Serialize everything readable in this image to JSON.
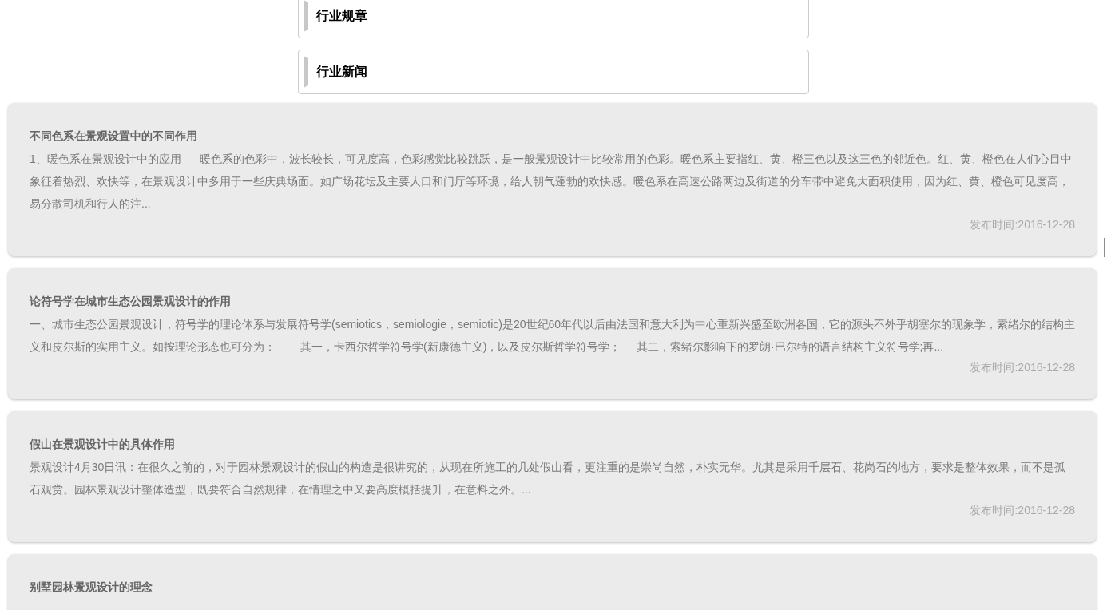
{
  "categories": [
    {
      "label": "行业规章"
    },
    {
      "label": "行业新闻"
    }
  ],
  "articles": [
    {
      "title": "不同色系在景观设置中的不同作用",
      "summary": "1、暖色系在景观设计中的应用      暖色系的色彩中，波长较长，可见度高，色彩感觉比较跳跃，是一般景观设计中比较常用的色彩。暖色系主要指红、黄、橙三色以及这三色的邻近色。红、黄、橙色在人们心目中象征着热烈、欢快等，在景观设计中多用于一些庆典场面。如广场花坛及主要人口和门厅等环境，给人朝气蓬勃的欢快感。暖色系在高速公路两边及街道的分车带中避免大面积使用，因为红、黄、橙色可见度高，易分散司机和行人的注...",
      "date": "发布时间:2016-12-28"
    },
    {
      "title": "论符号学在城市生态公园景观设计的作用",
      "summary": "一、城市生态公园景观设计，符号学的理论体系与发展符号学(semiotics，semiologie，semiotic)是20世纪60年代以后由法国和意大利为中心重新兴盛至欧洲各国，它的源头不外乎胡塞尔的现象学，索绪尔的结构主义和皮尔斯的实用主义。如按理论形态也可分为：        其一，卡西尔哲学符号学(新康德主义)，以及皮尔斯哲学符号学；     其二，索绪尔影响下的罗朗·巴尔特的语言结构主义符号学;再...",
      "date": "发布时间:2016-12-28"
    },
    {
      "title": "假山在景观设计中的具体作用",
      "summary": "景观设计4月30日讯：在很久之前的，对于园林景观设计的假山的构造是很讲究的，从现在所施工的几处假山看，更注重的是崇尚自然，朴实无华。尤其是采用千层石、花岗石的地方，要求是整体效果，而不是孤石观赏。园林景观设计整体造型，既要符合自然规律，在情理之中又要高度概括提升，在意料之外。...",
      "date": "发布时间:2016-12-28"
    },
    {
      "title": "别墅园林景观设计的理念"
    }
  ]
}
